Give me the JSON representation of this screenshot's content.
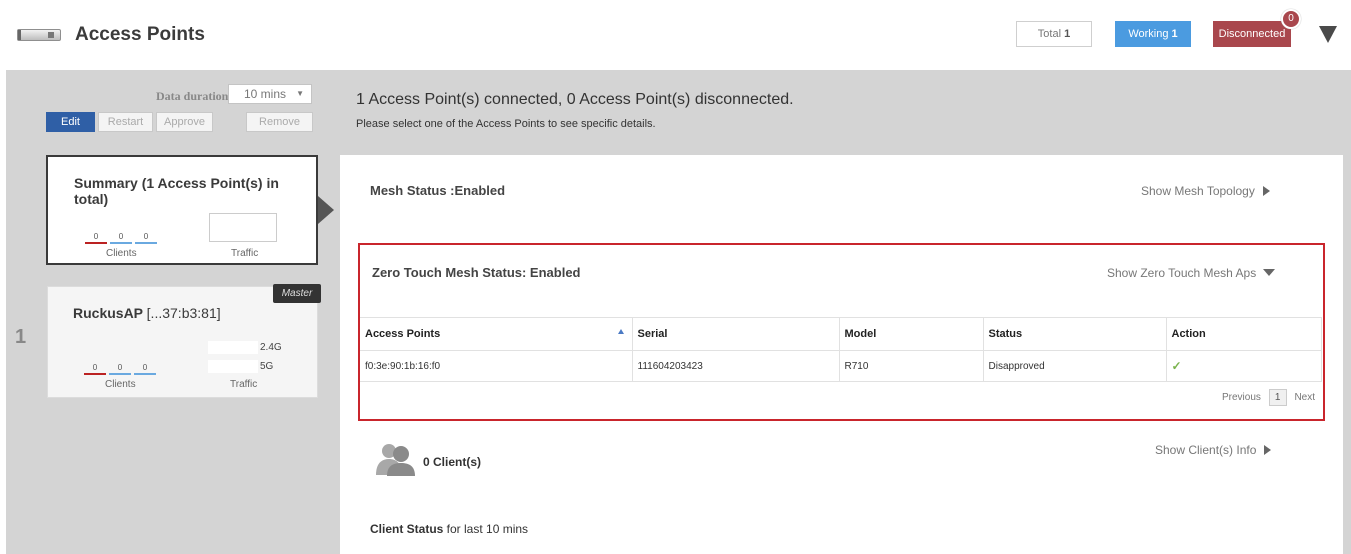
{
  "header": {
    "title": "Access Points",
    "total": {
      "label": "Total",
      "value": "1"
    },
    "working": {
      "label": "Working",
      "value": "1"
    },
    "disconnected": {
      "label": "Disconnected",
      "badge": "0"
    }
  },
  "toolbar": {
    "duration_label": "Data duration:",
    "duration_value": "10 mins",
    "edit": "Edit",
    "restart": "Restart",
    "approve": "Approve",
    "remove": "Remove"
  },
  "status_message": "1 Access Point(s) connected, 0 Access Point(s) disconnected.",
  "status_hint": "Please select one of the Access Points to see specific details.",
  "summary_card": {
    "title": "Summary (1 Access Point(s) in total)",
    "clients": [
      "0",
      "0",
      "0"
    ],
    "clients_label": "Clients",
    "traffic_label": "Traffic"
  },
  "ap_list": [
    {
      "index": "1",
      "name": "RuckusAP",
      "mac_suffix": "[...37:b3:81]",
      "tag": "Master",
      "clients": [
        "0",
        "0",
        "0"
      ],
      "clients_label": "Clients",
      "traffic_label": "Traffic",
      "bands": [
        "2.4G",
        "5G"
      ]
    }
  ],
  "mesh": {
    "title": "Mesh Status :Enabled",
    "link": "Show Mesh Topology"
  },
  "zero_touch": {
    "title": "Zero Touch Mesh Status: Enabled",
    "link": "Show Zero Touch Mesh Aps",
    "columns": [
      "Access Points",
      "Serial",
      "Model",
      "Status",
      "Action"
    ],
    "rows": [
      {
        "access_point": "f0:3e:90:1b:16:f0",
        "serial": "111604203423",
        "model": "R710",
        "status": "Disapproved",
        "action": "✓"
      }
    ],
    "pager": {
      "previous": "Previous",
      "page": "1",
      "next": "Next"
    }
  },
  "clients": {
    "count": "0 Client(s)",
    "link": "Show Client(s) Info",
    "status_bold": "Client Status",
    "status_rest": " for last 10 mins"
  },
  "colors": {
    "working": "#4b9be0",
    "disconnected": "#a9474d",
    "edit_button": "#2f5fa6",
    "highlight_border": "#c9252c",
    "approve_check": "#7ab34d"
  }
}
